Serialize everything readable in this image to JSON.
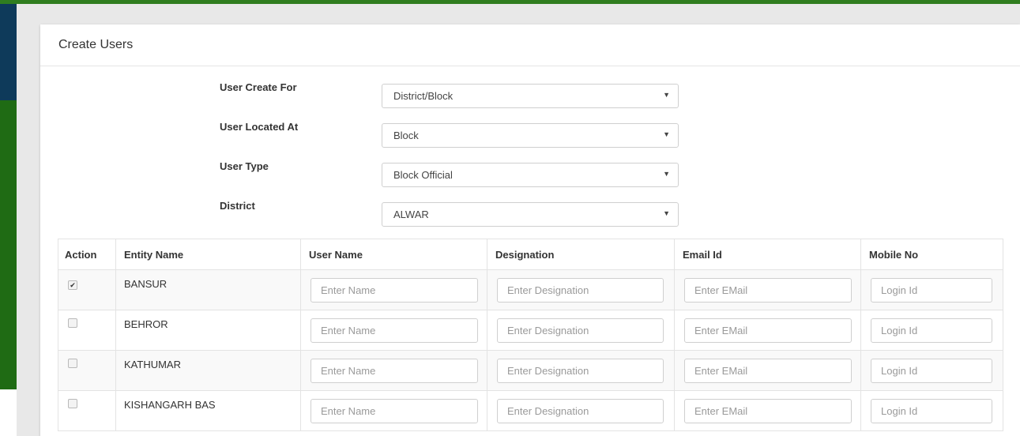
{
  "panel": {
    "title": "Create Users"
  },
  "form": {
    "fields": [
      {
        "label": "User Create For",
        "value": "District/Block"
      },
      {
        "label": "User Located At",
        "value": "Block"
      },
      {
        "label": "User Type",
        "value": "Block Official"
      },
      {
        "label": "District",
        "value": "ALWAR"
      }
    ]
  },
  "table": {
    "headers": {
      "action": "Action",
      "entity": "Entity Name",
      "user_name": "User Name",
      "designation": "Designation",
      "email": "Email Id",
      "mobile": "Mobile No"
    },
    "placeholders": {
      "user_name": "Enter Name",
      "designation": "Enter Designation",
      "email": "Enter EMail",
      "mobile": "Login Id"
    },
    "rows": [
      {
        "entity": "BANSUR",
        "checked": true
      },
      {
        "entity": "BEHROR",
        "checked": false
      },
      {
        "entity": "KATHUMAR",
        "checked": false
      },
      {
        "entity": "KISHANGARH BAS",
        "checked": false
      }
    ]
  },
  "icons": {
    "dropdown": "chevron-down-icon",
    "checkbox_checked": "check-icon"
  },
  "colors": {
    "top_strip": "#2f7d1f",
    "sidebar_blue": "#0e3a5a",
    "sidebar_green": "#1f6b14",
    "border": "#e3e3e3",
    "placeholder": "#9a9a9a"
  }
}
